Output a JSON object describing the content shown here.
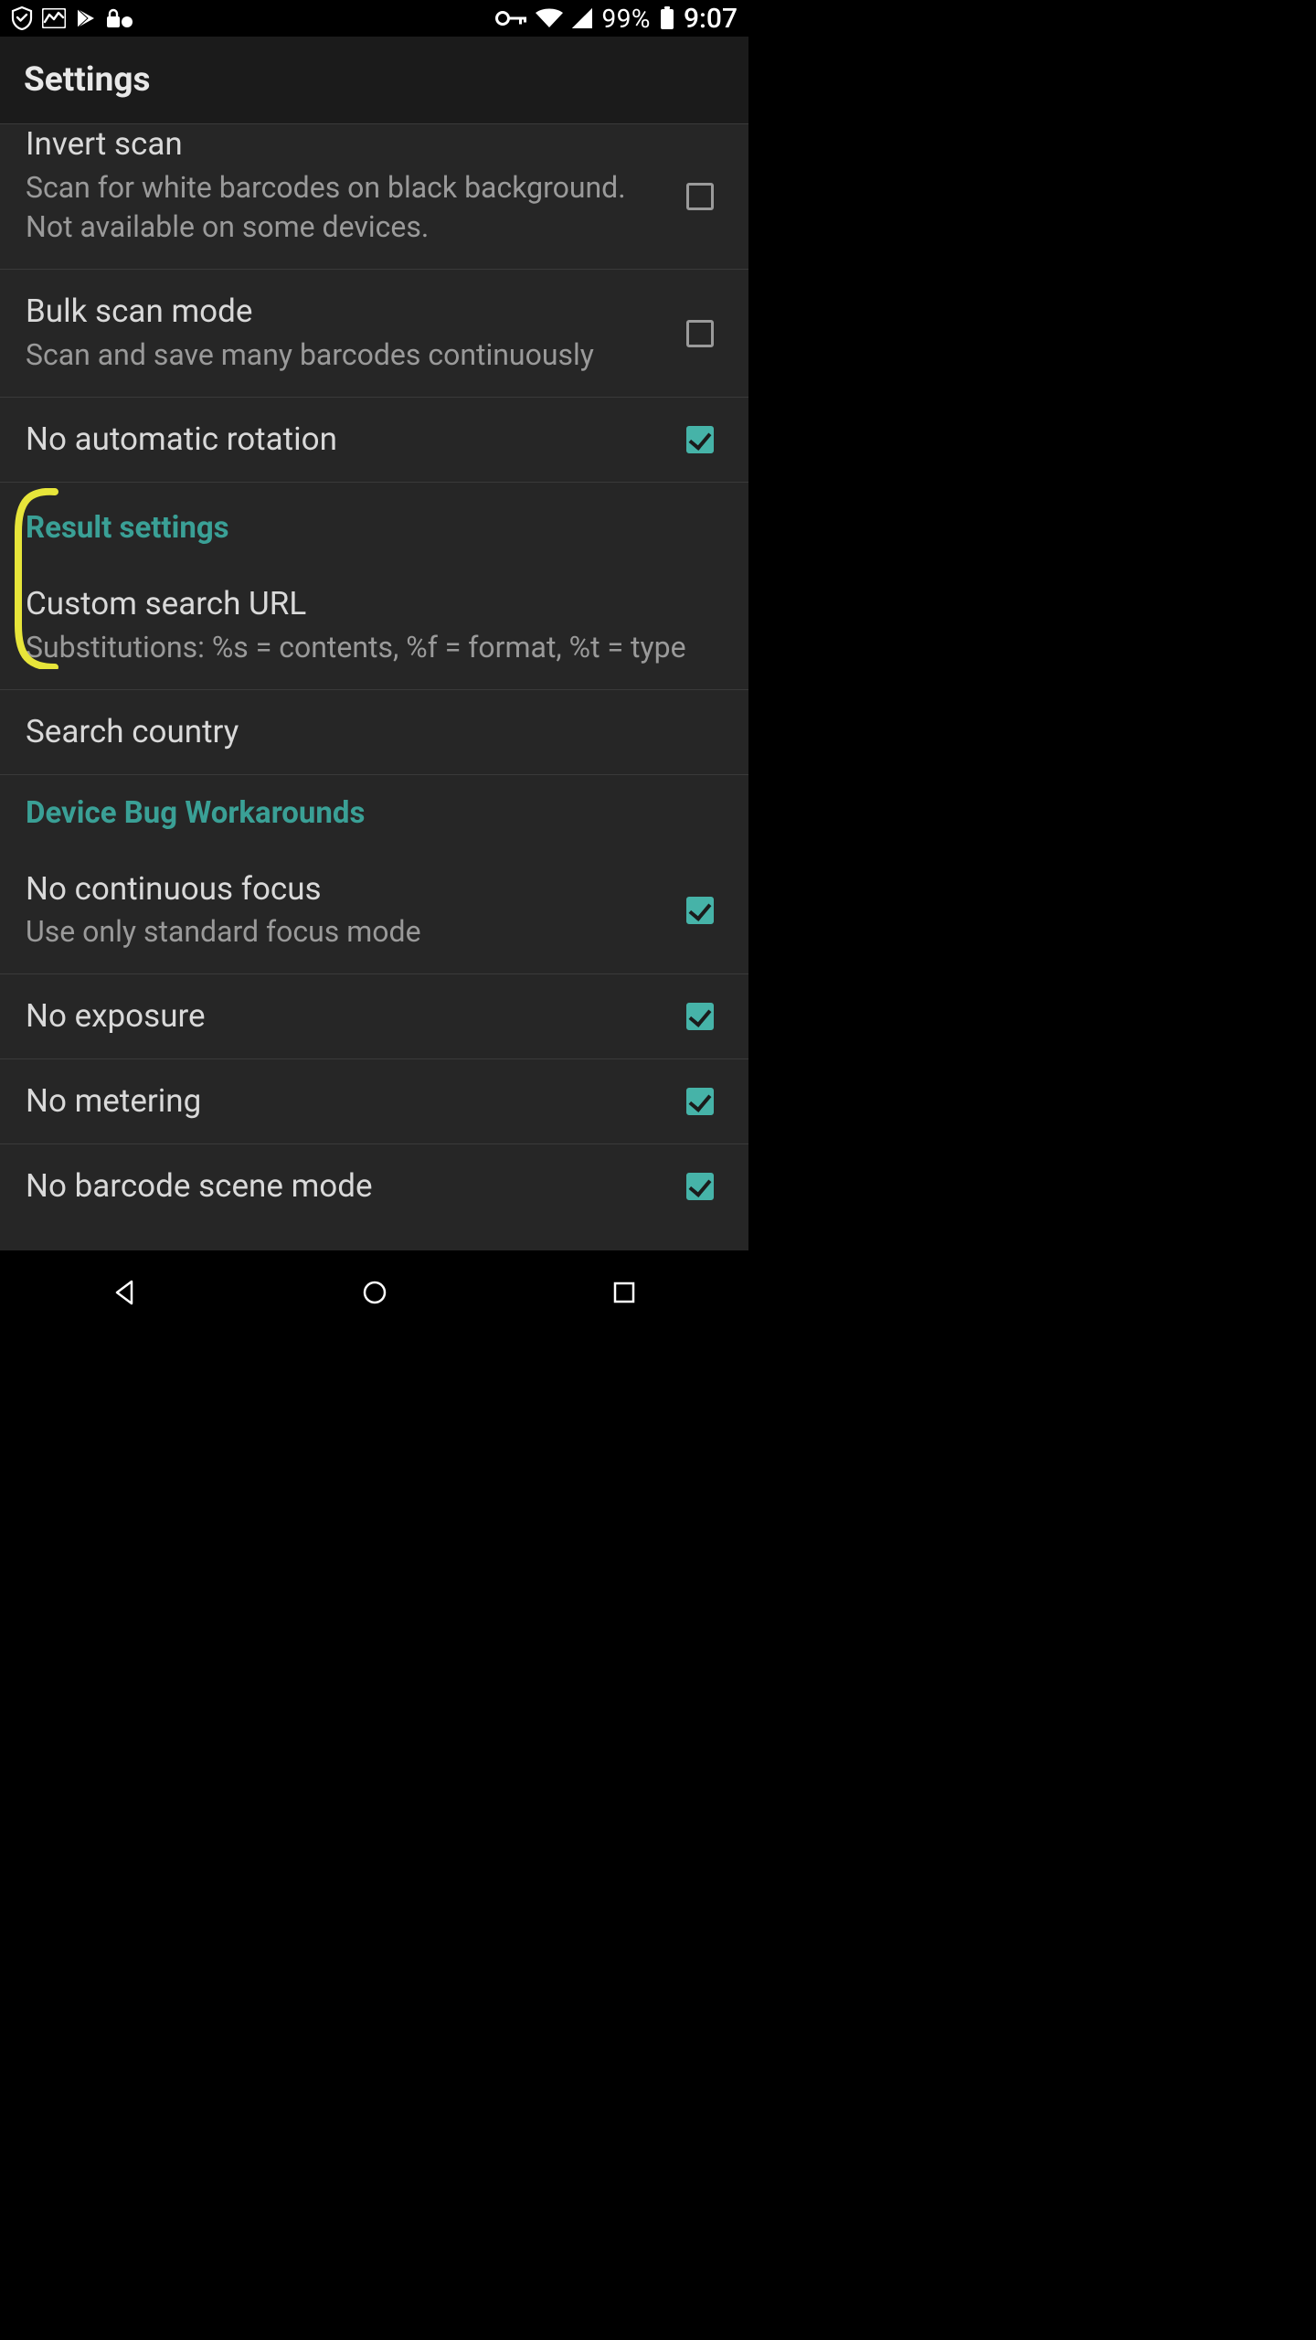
{
  "statusbar": {
    "battery_pct": "99%",
    "clock": "9:07"
  },
  "appbar": {
    "title": "Settings"
  },
  "sections": {
    "result_header": "Result settings",
    "device_header": "Device Bug Workarounds"
  },
  "rows": {
    "invert": {
      "title": "Invert scan",
      "sub": "Scan for white barcodes on black background. Not available on some devices.",
      "checked": false
    },
    "bulk": {
      "title": "Bulk scan mode",
      "sub": "Scan and save many barcodes continuously",
      "checked": false
    },
    "rotation": {
      "title": "No automatic rotation",
      "checked": true
    },
    "custom_search": {
      "title": "Custom search URL",
      "sub": "Substitutions: %s = contents, %f = format, %t = type"
    },
    "search_country": {
      "title": "Search country"
    },
    "no_cont_focus": {
      "title": "No continuous focus",
      "sub": "Use only standard focus mode",
      "checked": true
    },
    "no_exposure": {
      "title": "No exposure",
      "checked": true
    },
    "no_metering": {
      "title": "No metering",
      "checked": true
    },
    "no_barcode_scene": {
      "title": "No barcode scene mode",
      "checked": true
    }
  },
  "colors": {
    "accent": "#46b3a8",
    "bg": "#262626",
    "bar": "#1b1b1b",
    "text": "#d9d9d9",
    "subtext": "#9a9a9a",
    "annotation": "#e7e53a"
  }
}
